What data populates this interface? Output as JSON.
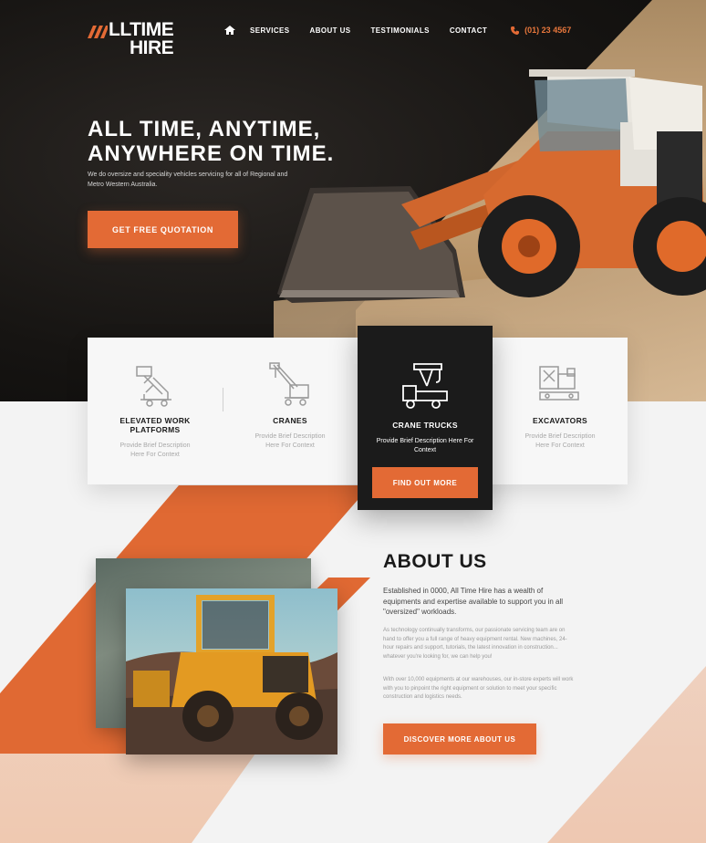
{
  "brand": {
    "logo_line1": "LLTIME",
    "logo_line2": "HIRE"
  },
  "nav": {
    "items": [
      {
        "label": "SERVICES"
      },
      {
        "label": "ABOUT US"
      },
      {
        "label": "TESTIMONIALS"
      },
      {
        "label": "CONTACT"
      }
    ],
    "phone": "(01) 23 4567"
  },
  "hero": {
    "headline_line1": "ALL TIME, ANYTIME,",
    "headline_line2": "ANYWHERE ON TIME.",
    "subtext": "We do oversize and speciality vehicles servicing for all of Regional and Metro Western Australia.",
    "cta": "GET FREE QUOTATION"
  },
  "services": [
    {
      "title": "ELEVATED WORK PLATFORMS",
      "desc": "Provide Brief Description Here For Context",
      "icon": "scissor-lift-icon"
    },
    {
      "title": "CRANES",
      "desc": "Provide Brief Description Here For Context",
      "icon": "crane-icon"
    },
    {
      "title": "CRANE TRUCKS",
      "desc": "Provide Brief Description Here For Context",
      "icon": "crane-truck-icon",
      "button": "FIND OUT MORE"
    },
    {
      "title": "EXCAVATORS",
      "desc": "Provide Brief Description Here For Context",
      "icon": "excavator-icon"
    }
  ],
  "about": {
    "title": "ABOUT US",
    "lead": "Established in 0000, All Time Hire has a wealth of equipments and expertise available to support you in all \"oversized\" workloads.",
    "p1": "As technology continually transforms, our passionate servicing team are on hand to offer you a full range of heavy equipment rental. New machines, 24-hour repairs and support, tutorials, the latest innovation in construction... whatever you're looking for, we can help you!",
    "p2": "With over 10,000 equipments at our warehouses, our in-store experts will work with you to pinpoint the right equipment or solution to meet your specific construction and logistics needs.",
    "button": "DISCOVER MORE ABOUT US"
  },
  "colors": {
    "accent": "#e36a35",
    "dark": "#1b1b1b"
  }
}
